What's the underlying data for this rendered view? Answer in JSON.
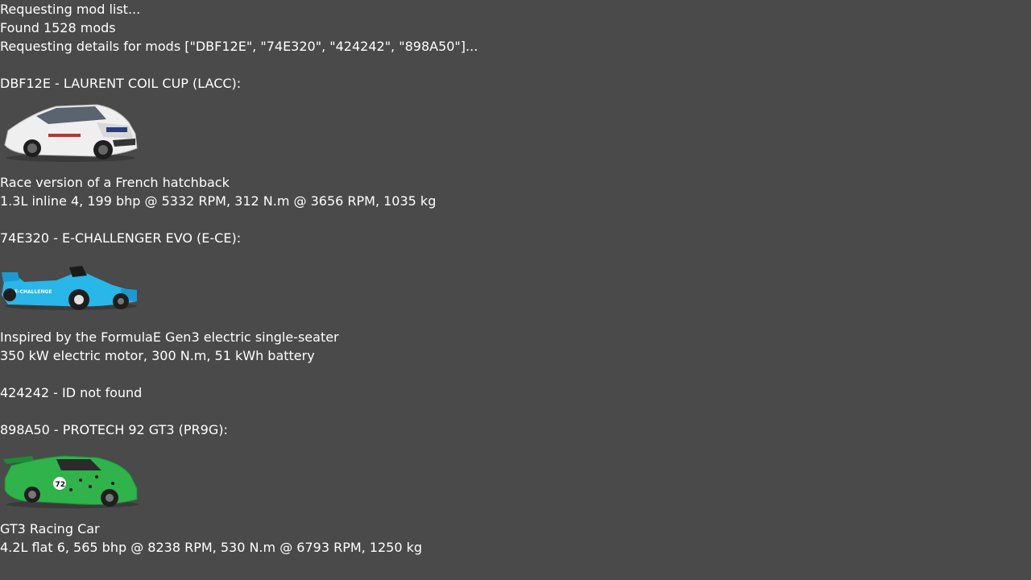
{
  "log": {
    "requesting_list": "Requesting mod list...",
    "found": "Found 1528 mods",
    "requesting_details": "Requesting details for mods [\"DBF12E\", \"74E320\", \"424242\", \"898A50\"]..."
  },
  "mods": [
    {
      "header": "DBF12E - LAURENT COIL CUP (LACC):",
      "description": "Race version of a French hatchback",
      "specs": "1.3L inline 4, 199 bhp @ 5332 RPM, 312 N.m @ 3656 RPM, 1035 kg",
      "image_icon": "white-hatchback-race-car-image",
      "color": "#e8e8e8"
    },
    {
      "header": "74E320 - E-CHALLENGER EVO (E-CE):",
      "description": "Inspired by the FormulaE Gen3 electric single-seater",
      "specs": "350 kW electric motor, 300 N.m, 51 kWh battery",
      "image_icon": "blue-formula-e-car-image",
      "color": "#29b6e8",
      "livery_text": "E-CHALLENGE"
    },
    {
      "header": "424242 - ID not found"
    },
    {
      "header": "898A50 - PROTECH 92 GT3 (PR9G):",
      "description": "GT3 Racing Car",
      "specs": "4.2L flat 6, 565 bhp @ 8238 RPM, 530 N.m @ 6793 RPM, 1250 kg",
      "image_icon": "green-gt3-race-car-image",
      "color": "#2fb34a",
      "livery_text": "72"
    }
  ]
}
